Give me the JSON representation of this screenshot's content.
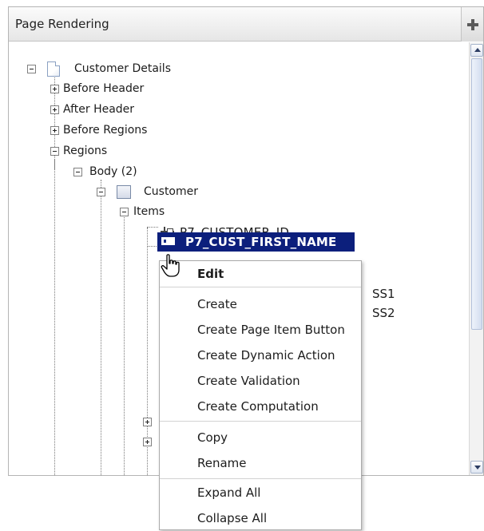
{
  "panel": {
    "title": "Page Rendering",
    "add_button_icon": "plus-icon"
  },
  "tree": {
    "root": {
      "label": "Customer Details",
      "icon": "page-icon",
      "expander": "collapse-icon"
    },
    "nodes": [
      {
        "label": "Before Header",
        "expander": "expand-icon"
      },
      {
        "label": "After Header",
        "expander": "expand-icon"
      },
      {
        "label": "Before Regions",
        "expander": "expand-icon"
      },
      {
        "label": "Regions",
        "expander": "collapse-icon"
      },
      {
        "label": "Body (2)",
        "expander": "collapse-icon"
      },
      {
        "label": "Customer",
        "icon": "region-icon",
        "expander": "collapse-icon"
      },
      {
        "label": "Items",
        "expander": "collapse-icon"
      },
      {
        "label": "P7_CUSTOMER_ID",
        "icon": "hidden-item-icon"
      },
      {
        "label": "P7_CUST_FIRST_NAME",
        "icon": "text-field-icon",
        "selected": true
      }
    ],
    "obscured_suffixes": [
      "SS1",
      "SS2"
    ]
  },
  "context_menu": {
    "items": [
      {
        "label": "Edit",
        "bold": true
      },
      {
        "label": "Create"
      },
      {
        "label": "Create Page Item Button"
      },
      {
        "label": "Create Dynamic Action"
      },
      {
        "label": "Create Validation"
      },
      {
        "label": "Create Computation"
      },
      {
        "label": "Copy"
      },
      {
        "label": "Rename"
      },
      {
        "label": "Expand All"
      },
      {
        "label": "Collapse All"
      }
    ]
  },
  "colors": {
    "selection": "#0c1f7c",
    "scrollbar_arrow": "#2d3d63"
  }
}
